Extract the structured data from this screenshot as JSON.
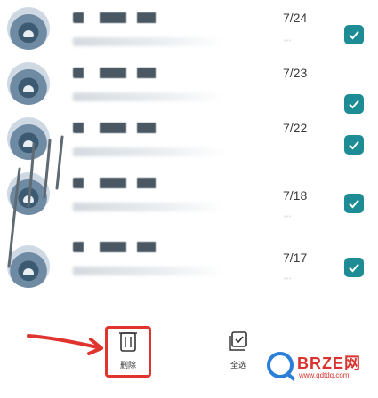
{
  "conversations": [
    {
      "date": "7/24",
      "sub": "…",
      "checked": true
    },
    {
      "date": "7/23",
      "sub": "",
      "checked": true
    },
    {
      "date": "7/22",
      "sub": "",
      "checked": true
    },
    {
      "date": "7/18",
      "sub": "…",
      "checked": true
    },
    {
      "date": "7/17",
      "sub": "…",
      "checked": true
    }
  ],
  "bottom_bar": {
    "delete_label": "删除",
    "more_label": "全选"
  },
  "watermark": {
    "brand": "BRZE网",
    "url": "www.qdtdq.com"
  },
  "colors": {
    "check": "#1e8c95",
    "highlight": "#e0342e",
    "logo_blue": "#2b7fd8",
    "logo_red": "#d8332f"
  }
}
